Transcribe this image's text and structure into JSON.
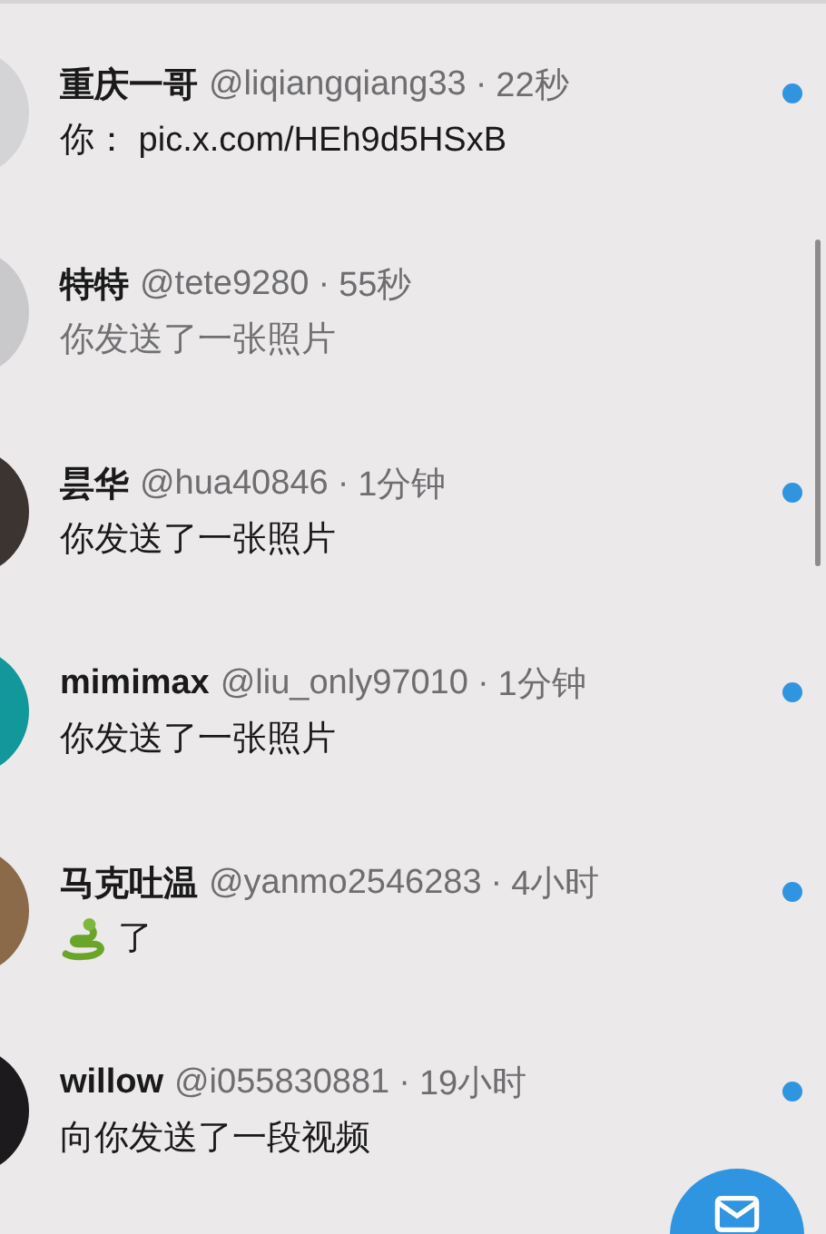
{
  "conversations": [
    {
      "name": "重庆一哥",
      "handle": "@liqiangqiang33",
      "separator": "·",
      "time": "22秒",
      "message": "你：  pic.x.com/HEh9d5HSxB",
      "unread": true,
      "avatar": {
        "color": "#d4d4d6"
      }
    },
    {
      "name": "特特",
      "handle": "@tete9280",
      "separator": "·",
      "time": "55秒",
      "message": "你发送了一张照片",
      "unread": false,
      "avatar": {
        "color": "#c9c9cb"
      }
    },
    {
      "name": "昙华",
      "handle": "@hua40846",
      "separator": "·",
      "time": "1分钟",
      "message": "你发送了一张照片",
      "unread": true,
      "avatar": {
        "color": "#3b3431"
      }
    },
    {
      "name": "mimimax",
      "handle": "@liu_only97010",
      "separator": "·",
      "time": "1分钟",
      "message": "你发送了一张照片",
      "unread": true,
      "avatar": {
        "color": "#12979a"
      }
    },
    {
      "name": "马克吐温",
      "handle": "@yanmo2546283",
      "separator": "·",
      "time": "4小时",
      "message": "了",
      "emoji": {
        "kind": "snake"
      },
      "unread": true,
      "avatar": {
        "color": "#8a6a48"
      }
    },
    {
      "name": "willow",
      "handle": "@i055830881",
      "separator": "·",
      "time": "19小时",
      "message": "向你发送了一段视频",
      "unread": true,
      "avatar": {
        "color": "#1c1a1c"
      }
    }
  ],
  "compose_button": {
    "kind": "message"
  }
}
